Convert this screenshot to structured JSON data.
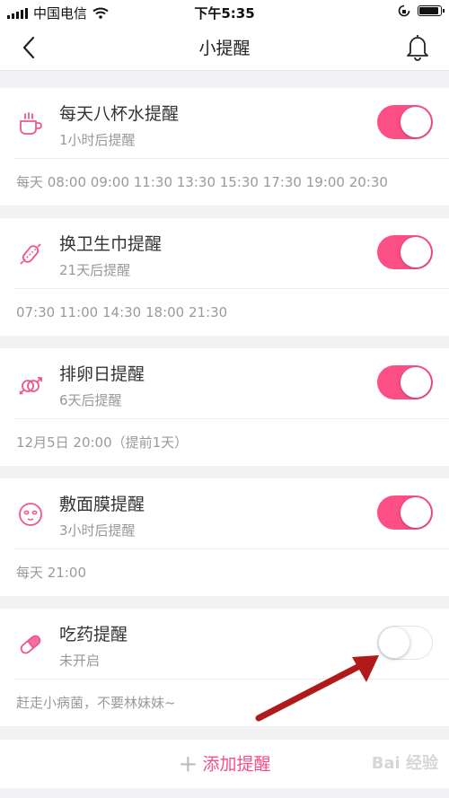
{
  "status_bar": {
    "carrier": "中国电信",
    "time": "下午5:35"
  },
  "nav": {
    "title": "小提醒",
    "back_icon": "chevron-left-icon",
    "bell_icon": "bell-icon"
  },
  "colors": {
    "accent": "#fb4f86",
    "background": "#f2f2f4",
    "arrow": "#b01a1a"
  },
  "reminders": [
    {
      "icon": "cup-icon",
      "name": "每天八杯水提醒",
      "sub": "1小时后提醒",
      "detail": "每天 08:00 09:00 11:30 13:30 15:30 17:30 19:00 20:30",
      "enabled": true
    },
    {
      "icon": "pad-icon",
      "name": "换卫生巾提醒",
      "sub": "21天后提醒",
      "detail": "07:30 11:00 14:30 18:00 21:30",
      "enabled": true
    },
    {
      "icon": "gender-icon",
      "name": "排卵日提醒",
      "sub": "6天后提醒",
      "detail": "12月5日 20:00（提前1天）",
      "enabled": true
    },
    {
      "icon": "face-mask-icon",
      "name": "敷面膜提醒",
      "sub": "3小时后提醒",
      "detail": "每天 21:00",
      "enabled": true
    },
    {
      "icon": "pill-icon",
      "name": "吃药提醒",
      "sub": "未开启",
      "detail": "赶走小病菌，不要林妹妹~",
      "enabled": false
    }
  ],
  "add_button": {
    "plus": "+",
    "label": "添加提醒"
  },
  "watermark": "Bai 经验"
}
